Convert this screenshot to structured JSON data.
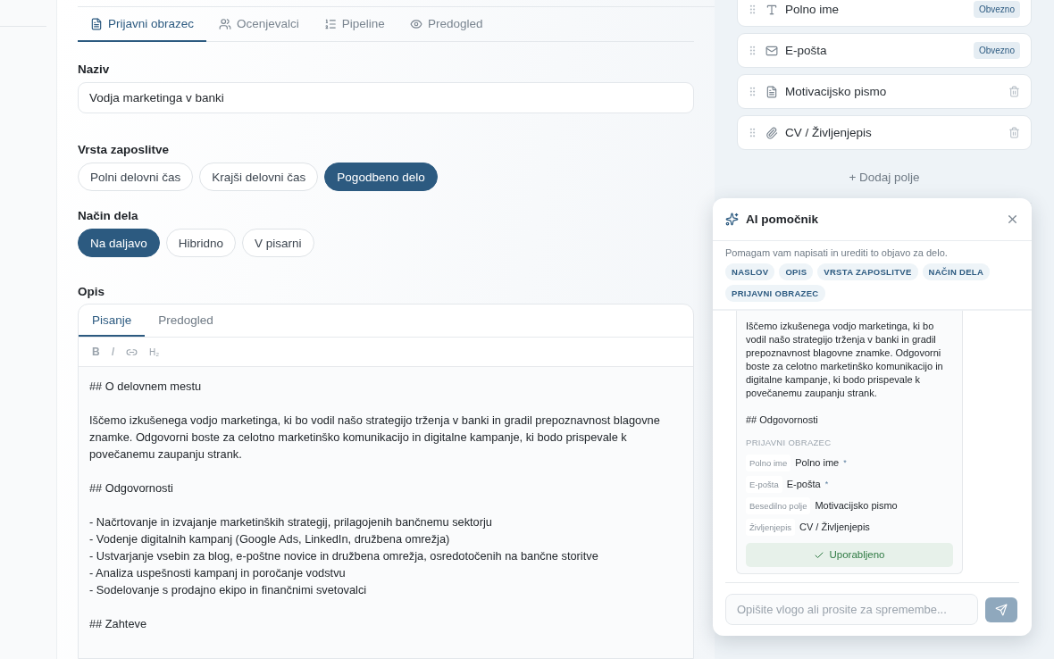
{
  "tabs": [
    {
      "label": "Prijavni obrazec",
      "kind": "form",
      "selected": true
    },
    {
      "label": "Ocenjevalci",
      "kind": "reviewers",
      "selected": false
    },
    {
      "label": "Pipeline",
      "kind": "pipeline",
      "selected": false
    },
    {
      "label": "Predogled",
      "kind": "preview",
      "selected": false
    }
  ],
  "title_field": {
    "label": "Naziv",
    "value": "Vodja marketinga v banki"
  },
  "employment_type": {
    "label": "Vrsta zaposlitve",
    "options": [
      {
        "label": "Polni delovni čas",
        "selected": false
      },
      {
        "label": "Krajši delovni čas",
        "selected": false
      },
      {
        "label": "Pogodbeno delo",
        "selected": true
      }
    ]
  },
  "work_mode": {
    "label": "Način dela",
    "options": [
      {
        "label": "Na daljavo",
        "selected": true
      },
      {
        "label": "Hibridno",
        "selected": false
      },
      {
        "label": "V pisarni",
        "selected": false
      }
    ]
  },
  "description": {
    "label": "Opis",
    "tabs": [
      {
        "label": "Pisanje",
        "selected": true
      },
      {
        "label": "Predogled",
        "selected": false
      }
    ],
    "toolbar": [
      {
        "kind": "bold",
        "label": "B"
      },
      {
        "kind": "italic",
        "label": "I"
      },
      {
        "kind": "link"
      },
      {
        "kind": "heading",
        "label": "H₂"
      }
    ],
    "blocks": [
      {
        "lines": [
          "## O delovnem mestu"
        ]
      },
      {
        "lines": [
          "Iščemo izkušenega vodjo marketinga, ki bo vodil našo strategijo trženja v banki in gradil prepoznavnost blagovne",
          "znamke. Odgovorni boste za celotno marketinško komunikacijo in digitalne kampanje, ki bodo prispevale k",
          "povečanemu zaupanju strank."
        ]
      },
      {
        "lines": [
          "## Odgovornosti"
        ]
      },
      {
        "lines": [
          "- Načrtovanje in izvajanje marketinških strategij, prilagojenih bančnemu sektorju",
          "- Vodenje digitalnih kampanj (Google Ads, LinkedIn, družbena omrežja)",
          "- Ustvarjanje vsebin za blog, e-poštne novice in družbena omrežja, osredotočenih na bančne storitve",
          "- Analiza uspešnosti kampanj in poročanje vodstvu",
          "- Sodelovanje s prodajno ekipo in finančnimi svetovalci"
        ]
      },
      {
        "lines": [
          "## Zahteve"
        ]
      }
    ]
  },
  "form_fields": [
    {
      "label": "Polno ime",
      "kind": "text",
      "required": true,
      "badge": "Obvezno"
    },
    {
      "label": "E-pošta",
      "kind": "email",
      "required": true,
      "badge": "Obvezno"
    },
    {
      "label": "Motivacijsko pismo",
      "kind": "textarea",
      "required": false
    },
    {
      "label": "CV / Življenjepis",
      "kind": "file",
      "required": false
    }
  ],
  "add_field": "+ Dodaj polje",
  "assistant": {
    "title": "AI pomočnik",
    "intro": "Pomagam vam napisati in urediti to objavo za delo.",
    "tags": [
      "NASLOV",
      "OPIS",
      "VRSTA ZAPOSLITVE",
      "NAČIN DELA",
      "PRIJAVNI OBRAZEC"
    ],
    "message": {
      "lines": [
        "Iščemo izkušenega vodjo marketinga, ki bo",
        "vodil našo strategijo trženja v banki in gradil",
        "prepoznavnost blagovne znamke. Odgovorni",
        "boste za celotno marketinško komunikacijo in",
        "digitalne kampanje, ki bodo prispevale k",
        "povečanemu zaupanju strank."
      ],
      "heading": "## Odgovornosti",
      "form_title": "PRIJAVNI OBRAZEC",
      "fields": [
        {
          "type": "Polno ime",
          "label": "Polno ime",
          "mark": "*"
        },
        {
          "type": "E-pošta",
          "label": "E-pošta",
          "mark": "*"
        },
        {
          "type": "Besedilno polje",
          "label": "Motivacijsko pismo"
        },
        {
          "type": "Življenjepis",
          "label": "CV / Življenjepis"
        }
      ],
      "applied": {
        "label": "Uporabljeno",
        "done": true
      }
    },
    "input_placeholder": "Opišite vlogo ali prosite za spremembe..."
  }
}
